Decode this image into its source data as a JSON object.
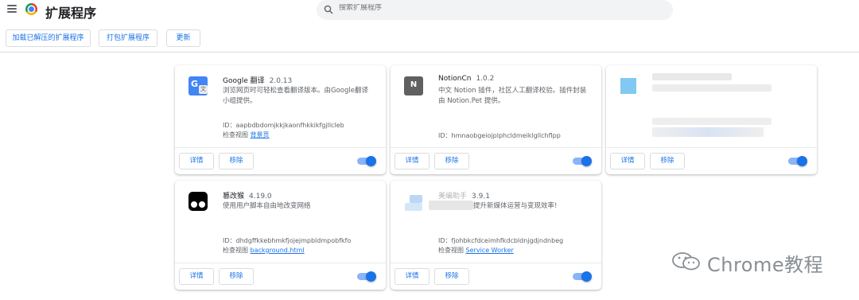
{
  "header": {
    "title": "扩展程序",
    "search_placeholder": "搜索扩展程序"
  },
  "toolbar": {
    "load_unpacked": "加载已解压的扩展程序",
    "pack": "打包扩展程序",
    "update": "更新"
  },
  "buttons": {
    "details": "详情",
    "remove": "移除"
  },
  "extensions": [
    {
      "name": "Google 翻译",
      "version": "2.0.13",
      "description": "浏览网页时可轻松查看翻译版本。由Google翻译小组提供。",
      "id_label": "ID：aapbdbdomjkkjkaonfhkkikfgjllcleb",
      "inspect_label": "检查视图",
      "inspect_link": "背景页",
      "enabled": true
    },
    {
      "name": "NotionCn",
      "version": "1.0.2",
      "description": "中文 Notion 插件，社区人工翻译校验。插件封装由 Notion.Pet 提供。",
      "id_label": "ID：hmnaobgeiojplphcldmeiklgllchflpp",
      "enabled": true
    },
    {
      "enabled": true
    },
    {
      "name": "篡改猴",
      "version": "4.19.0",
      "description": "使用用户脚本自由地改变网络",
      "id_label": "ID：dhdgffkkebhmkfjojejmpbldmpobfkfo",
      "inspect_label": "检查视图",
      "inspect_link": "background.html",
      "enabled": true
    },
    {
      "name": "美编助手",
      "version": "3.9.1",
      "description": "提升新媒体运营与变现效率!",
      "id_label": "ID：fjohbkcfdceimhfkdcbldnjgdjndnbeg",
      "inspect_label": "检查视图",
      "inspect_link": "Service Worker",
      "enabled": true
    }
  ],
  "watermark": {
    "text": "Chrome教程"
  },
  "colors": {
    "accent": "#1a73e8",
    "toggle_track": "#8ab4f8",
    "search_bg": "#f1f3f4"
  }
}
